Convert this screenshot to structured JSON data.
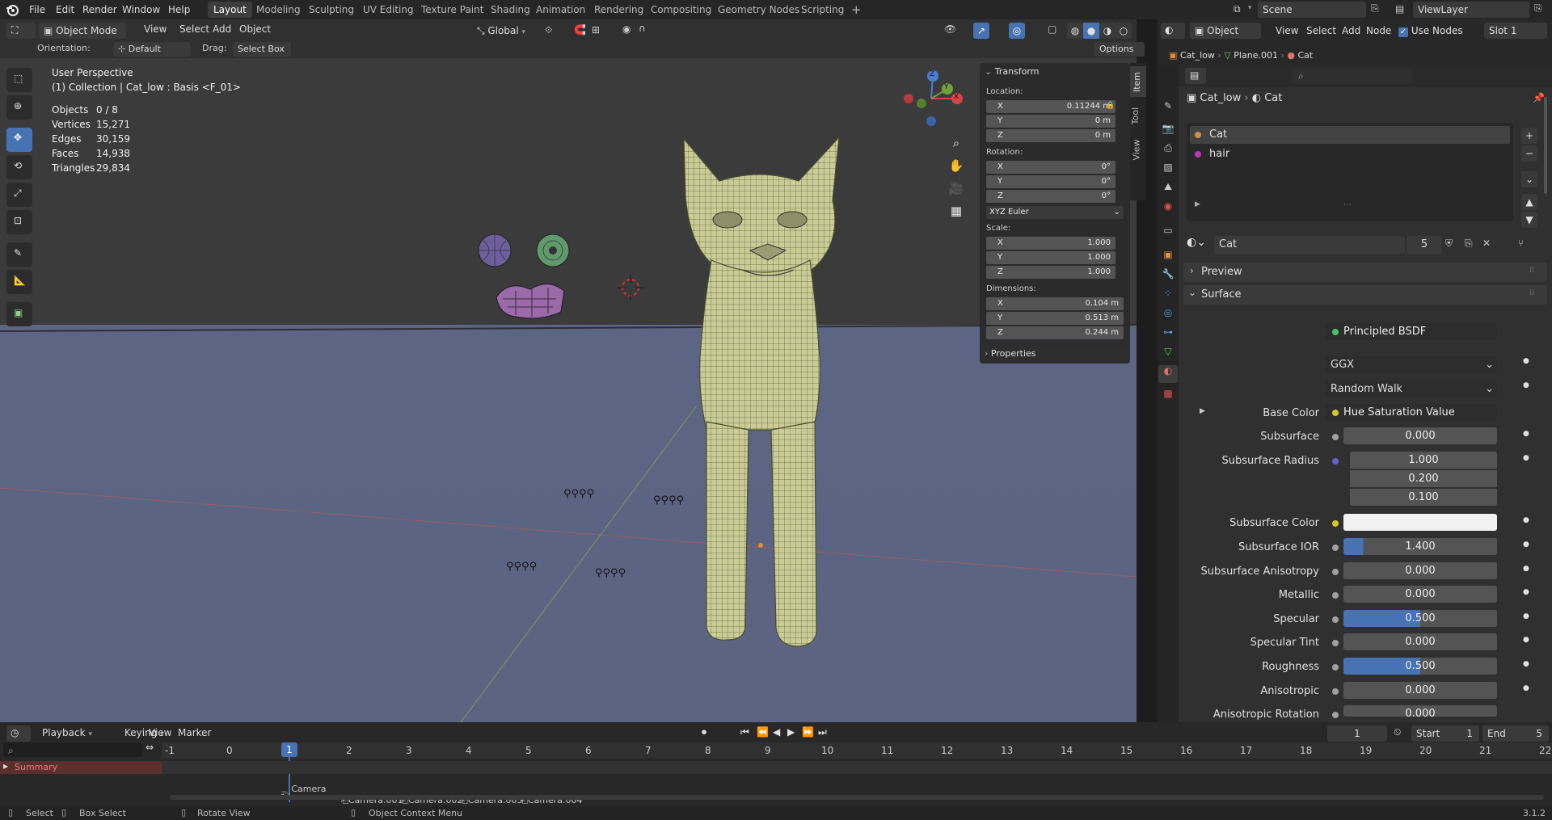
{
  "colors": {
    "accent": "#4772b3",
    "selected_row": "#334d80",
    "viewport_floor": "#5d6584",
    "mesh": "#c9cc95"
  },
  "topbar": {
    "menus": [
      "File",
      "Edit",
      "Render",
      "Window",
      "Help"
    ],
    "workspaces": [
      "Layout",
      "Modeling",
      "Sculpting",
      "UV Editing",
      "Texture Paint",
      "Shading",
      "Animation",
      "Rendering",
      "Compositing",
      "Geometry Nodes",
      "Scripting"
    ],
    "active_workspace": "Layout",
    "add_tab": "+",
    "scene_label": "Scene",
    "view_layer_label": "ViewLayer"
  },
  "viewport_header": {
    "mode": "Object Mode",
    "menus": [
      "View",
      "Select",
      "Add",
      "Object"
    ],
    "transform_orientation": "Global",
    "orientation_label": "Orientation:",
    "orientation_value": "Default",
    "drag_label": "Drag:",
    "drag_value": "Select Box",
    "options_label": "Options"
  },
  "viewport": {
    "view_name": "User Perspective",
    "collection_info": "(1) Collection | Cat_low : Basis <F_01>",
    "stats": [
      {
        "label": "Objects",
        "value": "0 / 8"
      },
      {
        "label": "Vertices",
        "value": "15,271"
      },
      {
        "label": "Edges",
        "value": "30,159"
      },
      {
        "label": "Faces",
        "value": "14,938"
      },
      {
        "label": "Triangles",
        "value": "29,834"
      }
    ],
    "gizmo": {
      "z": "Z",
      "y": "Y",
      "x": "X"
    }
  },
  "n_panel": {
    "tabs": [
      "Item",
      "Tool",
      "View"
    ],
    "transform_title": "Transform",
    "location_label": "Location:",
    "location": [
      {
        "axis": "X",
        "value": "0.11244 m"
      },
      {
        "axis": "Y",
        "value": "0 m"
      },
      {
        "axis": "Z",
        "value": "0 m"
      }
    ],
    "rotation_label": "Rotation:",
    "rotation": [
      {
        "axis": "X",
        "value": "0°"
      },
      {
        "axis": "Y",
        "value": "0°"
      },
      {
        "axis": "Z",
        "value": "0°"
      }
    ],
    "rotation_mode": "XYZ Euler",
    "scale_label": "Scale:",
    "scale": [
      {
        "axis": "X",
        "value": "1.000"
      },
      {
        "axis": "Y",
        "value": "1.000"
      },
      {
        "axis": "Z",
        "value": "1.000"
      }
    ],
    "dimensions_label": "Dimensions:",
    "dimensions": [
      {
        "axis": "X",
        "value": "0.104 m"
      },
      {
        "axis": "Y",
        "value": "0.513 m"
      },
      {
        "axis": "Z",
        "value": "0.244 m"
      }
    ],
    "properties_title": "Properties"
  },
  "outliner": {
    "shader_mode": "Object",
    "menus": [
      "View",
      "Select",
      "Add",
      "Node"
    ],
    "use_nodes_label": "Use Nodes",
    "slot_label": "Slot 1",
    "breadcrumb": [
      "Cat_low",
      "Plane.001",
      "Cat"
    ]
  },
  "properties": {
    "header_object": "Cat_low",
    "header_material": "Cat",
    "material_slots": [
      {
        "name": "Cat",
        "selected": true
      },
      {
        "name": "hair",
        "selected": false
      }
    ],
    "material_name": "Cat",
    "material_users": "5",
    "preview_label": "Preview",
    "surface_label": "Surface",
    "surface_shader_label": "Surface",
    "surface_shader": "Principled BSDF",
    "distribution": "GGX",
    "subsurface_method": "Random Walk",
    "base_color_label": "Base Color",
    "base_color_value": "Hue Saturation Value",
    "subsurface_label": "Subsurface",
    "subsurface_value": "0.000",
    "subsurface_radius_label": "Subsurface Radius",
    "subsurface_radius": [
      "1.000",
      "0.200",
      "0.100"
    ],
    "subsurface_color_label": "Subsurface Color",
    "subsurface_ior_label": "Subsurface IOR",
    "subsurface_ior_value": "1.400",
    "subsurface_anisotropy_label": "Subsurface Anisotropy",
    "subsurface_anisotropy_value": "0.000",
    "metallic_label": "Metallic",
    "metallic_value": "0.000",
    "specular_label": "Specular",
    "specular_value": "0.500",
    "specular_tint_label": "Specular Tint",
    "specular_tint_value": "0.000",
    "roughness_label": "Roughness",
    "roughness_value": "0.500",
    "anisotropic_label": "Anisotropic",
    "anisotropic_value": "0.000",
    "anisotropic_rotation_label": "Anisotropic Rotation",
    "anisotropic_rotation_value": "0.000"
  },
  "timeline": {
    "menus": [
      "Playback",
      "Keying",
      "View",
      "Marker"
    ],
    "current_frame": "1",
    "start_label": "Start",
    "start_value": "1",
    "end_label": "End",
    "end_value": "5",
    "ruler": [
      "-1",
      "0",
      "1",
      "2",
      "3",
      "4",
      "5",
      "6",
      "7",
      "8",
      "9",
      "10",
      "11",
      "12",
      "13",
      "14",
      "15",
      "16",
      "17",
      "18",
      "19",
      "20",
      "21",
      "22"
    ],
    "summary_label": "Summary",
    "markers": [
      "Camera",
      "Camera.001",
      "Camera.002",
      "Camera.003",
      "Camera.004"
    ]
  },
  "statusbar": {
    "select": "Select",
    "box_select": "Box Select",
    "rotate_view": "Rotate View",
    "context_menu": "Object Context Menu",
    "version": "3.1.2"
  }
}
